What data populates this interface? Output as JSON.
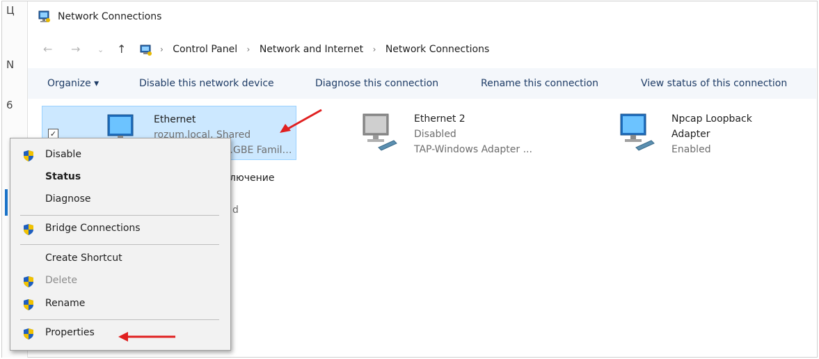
{
  "window": {
    "title": "Network Connections"
  },
  "address": {
    "crumbs": [
      "Control Panel",
      "Network and Internet",
      "Network Connections"
    ],
    "separator": "›"
  },
  "toolbar": {
    "organize": "Organize ▾",
    "disable": "Disable this network device",
    "diagnose": "Diagnose this connection",
    "rename": "Rename this connection",
    "view_status": "View status of this connection"
  },
  "connections": [
    {
      "name": "Ethernet",
      "status": "rozum.local, Shared",
      "adapter": "…GBE Famil…"
    },
    {
      "name": "Ethernet 2",
      "status": "Disabled",
      "adapter": "TAP-Windows Adapter ..."
    },
    {
      "name_line1": "Npcap Loopback",
      "name_line2": "Adapter",
      "status": "Enabled"
    }
  ],
  "hidden_fragments": {
    "item_partial": "лючение",
    "item_partial2": "d",
    "left_glyph_1": "Ц",
    "left_glyph_2": "N",
    "left_glyph_3": "6"
  },
  "context_menu": {
    "items": [
      "Disable",
      "Status",
      "Diagnose",
      "Bridge Connections",
      "Create Shortcut",
      "Delete",
      "Rename",
      "Properties"
    ]
  },
  "colors": {
    "selection_bg": "#cce8ff",
    "selection_border": "#99d1ff",
    "annotation_arrow": "#e02020",
    "cmdbar_bg": "#f4f7fb"
  }
}
